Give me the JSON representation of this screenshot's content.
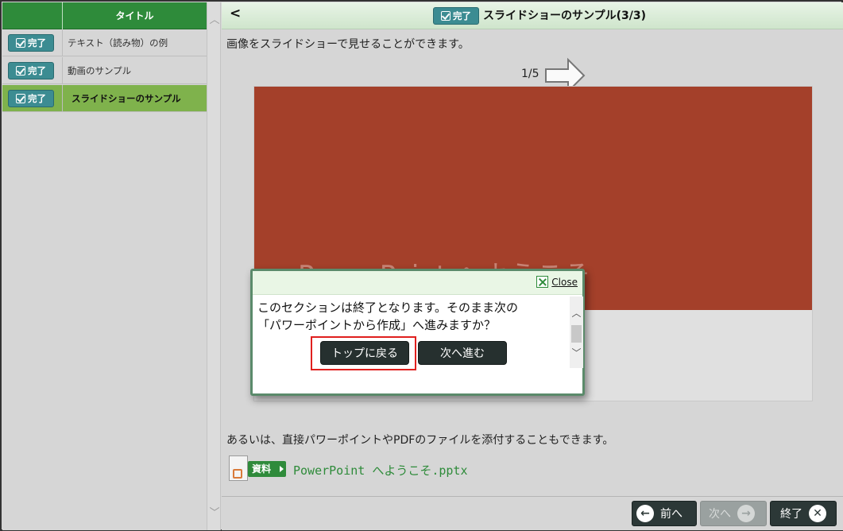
{
  "sidebar": {
    "header_title": "タイトル",
    "items": [
      {
        "badge": "完了",
        "label": "テキスト（読み物）の例",
        "active": false
      },
      {
        "badge": "完了",
        "label": "動画のサンプル",
        "active": false
      },
      {
        "badge": "完了",
        "label": "スライドショーのサンプル",
        "active": true
      }
    ]
  },
  "topbar": {
    "back": "<",
    "badge": "完了",
    "title": "スライドショーのサンプル(3/3)"
  },
  "content": {
    "intro": "画像をスライドショーで見せることができます。",
    "counter": "1/5",
    "slide_text": "PowerPoint へようこそ",
    "attach_text": "あるいは、直接パワーポイントやPDFのファイルを添付することもできます。",
    "doc_tag": "資料",
    "file_name": "PowerPoint へようこそ.pptx"
  },
  "dialog": {
    "close_label": "Close",
    "message_line1": "このセクションは終了となります。そのまま次の",
    "message_line2": "「パワーポイントから作成」へ進みますか？",
    "btn_top": "トップに戻る",
    "btn_next": "次へ進む"
  },
  "nav": {
    "prev": "前へ",
    "next": "次へ",
    "finish": "終了"
  },
  "colors": {
    "accent_green": "#2e8b3a",
    "badge_teal": "#3c8c92",
    "slide_bg": "#a4402a",
    "highlight_red": "#e0201e"
  }
}
